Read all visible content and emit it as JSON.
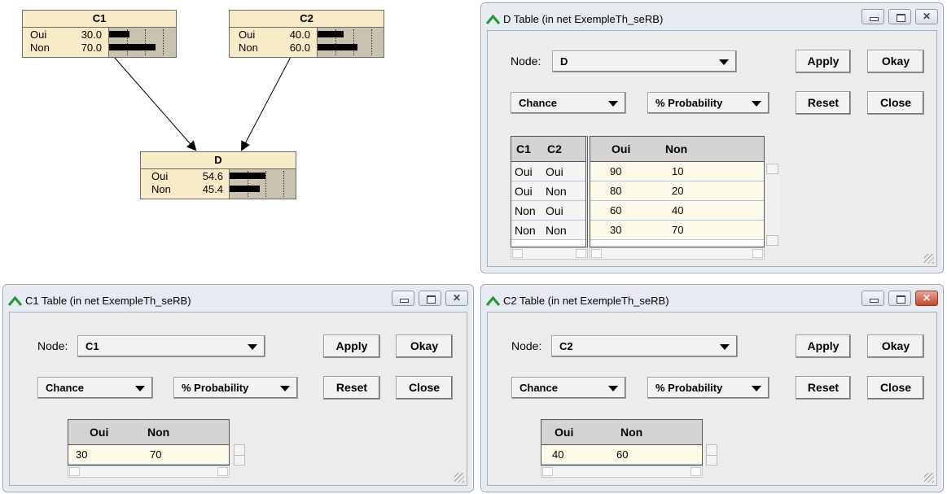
{
  "network": {
    "nodes": [
      {
        "id": "C1",
        "title": "C1",
        "states": [
          {
            "name": "Oui",
            "value": "30.0",
            "fraction": 0.3
          },
          {
            "name": "Non",
            "value": "70.0",
            "fraction": 0.7
          }
        ]
      },
      {
        "id": "C2",
        "title": "C2",
        "states": [
          {
            "name": "Oui",
            "value": "40.0",
            "fraction": 0.4
          },
          {
            "name": "Non",
            "value": "60.0",
            "fraction": 0.6
          }
        ]
      },
      {
        "id": "D",
        "title": "D",
        "states": [
          {
            "name": "Oui",
            "value": "54.6",
            "fraction": 0.546
          },
          {
            "name": "Non",
            "value": "45.4",
            "fraction": 0.454
          }
        ]
      }
    ]
  },
  "common": {
    "node_label": "Node:",
    "apply": "Apply",
    "okay": "Okay",
    "reset": "Reset",
    "close": "Close",
    "chance": "Chance",
    "probability": "% Probability"
  },
  "d_window": {
    "title": "D Table (in net ExempleTh_seRB)",
    "node_value": "D",
    "parent_headers": [
      "C1",
      "C2"
    ],
    "state_headers": [
      "Oui",
      "Non"
    ],
    "rows": [
      {
        "parents": [
          "Oui",
          "Oui"
        ],
        "values": [
          "90",
          "10"
        ]
      },
      {
        "parents": [
          "Oui",
          "Non"
        ],
        "values": [
          "80",
          "20"
        ]
      },
      {
        "parents": [
          "Non",
          "Oui"
        ],
        "values": [
          "60",
          "40"
        ]
      },
      {
        "parents": [
          "Non",
          "Non"
        ],
        "values": [
          "30",
          "70"
        ]
      }
    ]
  },
  "c1_window": {
    "title": "C1 Table (in net ExempleTh_seRB)",
    "node_value": "C1",
    "state_headers": [
      "Oui",
      "Non"
    ],
    "values": [
      "30",
      "70"
    ]
  },
  "c2_window": {
    "title": "C2 Table (in net ExempleTh_seRB)",
    "node_value": "C2",
    "state_headers": [
      "Oui",
      "Non"
    ],
    "values": [
      "40",
      "60"
    ]
  },
  "colors": {
    "node_title_bg": "#f7ecc7",
    "bars_bg": "#c9c2b0",
    "window_bg": "#e6ebf1",
    "cell_bg": "#fffbea",
    "close_active": "#c5472f"
  }
}
